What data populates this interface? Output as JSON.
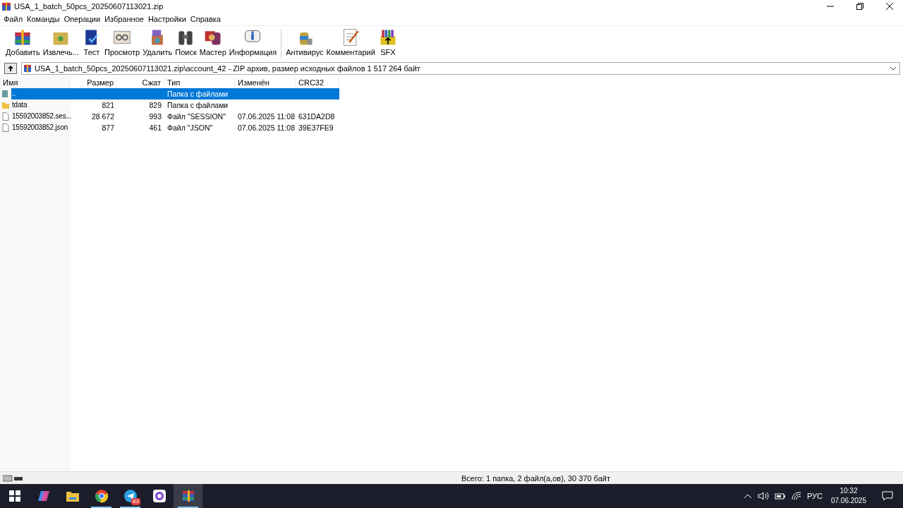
{
  "window": {
    "title": "USA_1_batch_50pcs_20250607113021.zip"
  },
  "menu": [
    "Файл",
    "Команды",
    "Операции",
    "Избранное",
    "Настройки",
    "Справка"
  ],
  "toolbar": {
    "groups": [
      [
        "Добавить",
        "Извлечь...",
        "Тест",
        "Просмотр",
        "Удалить",
        "Поиск",
        "Мастер",
        "Информация"
      ],
      [
        "Антивирус",
        "Комментарий",
        "SFX"
      ]
    ]
  },
  "address": {
    "path": "USA_1_batch_50pcs_20250607113021.zip\\account_42 - ZIP архив, размер исходных файлов 1 517 264 байт"
  },
  "table": {
    "columns": [
      "Имя",
      "Размер",
      "Сжат",
      "Тип",
      "Изменён",
      "CRC32"
    ],
    "rows": [
      {
        "kind": "parent",
        "selected": true,
        "cells": [
          "..",
          "",
          "",
          "Папка с файлами",
          "",
          ""
        ]
      },
      {
        "kind": "folder",
        "selected": false,
        "cells": [
          "tdata",
          "821",
          "829",
          "Папка с файлами",
          "",
          ""
        ]
      },
      {
        "kind": "file",
        "selected": false,
        "cells": [
          "15592003852.ses...",
          "28 672",
          "993",
          "Файл \"SESSION\"",
          "07.06.2025 11:08",
          "631DA2D8"
        ]
      },
      {
        "kind": "file",
        "selected": false,
        "cells": [
          "15592003852.json",
          "877",
          "461",
          "Файл \"JSON\"",
          "07.06.2025 11:08",
          "39E37FE9"
        ]
      }
    ]
  },
  "status_bar": {
    "text": "Всего: 1 папка, 2 файл(а,ов), 30 370 байт"
  },
  "taskbar": {
    "apps": [
      {
        "kind": "copilot",
        "running": false,
        "selected": false
      },
      {
        "kind": "explorer",
        "running": false,
        "selected": false
      },
      {
        "kind": "chrome",
        "running": true,
        "selected": false
      },
      {
        "kind": "telegram",
        "running": true,
        "selected": false,
        "badge": "83"
      },
      {
        "kind": "messenger",
        "running": false,
        "selected": false
      },
      {
        "kind": "archiver",
        "running": true,
        "selected": true
      }
    ],
    "language": "РУС",
    "time": "10:32",
    "date": "07.06.2025"
  }
}
